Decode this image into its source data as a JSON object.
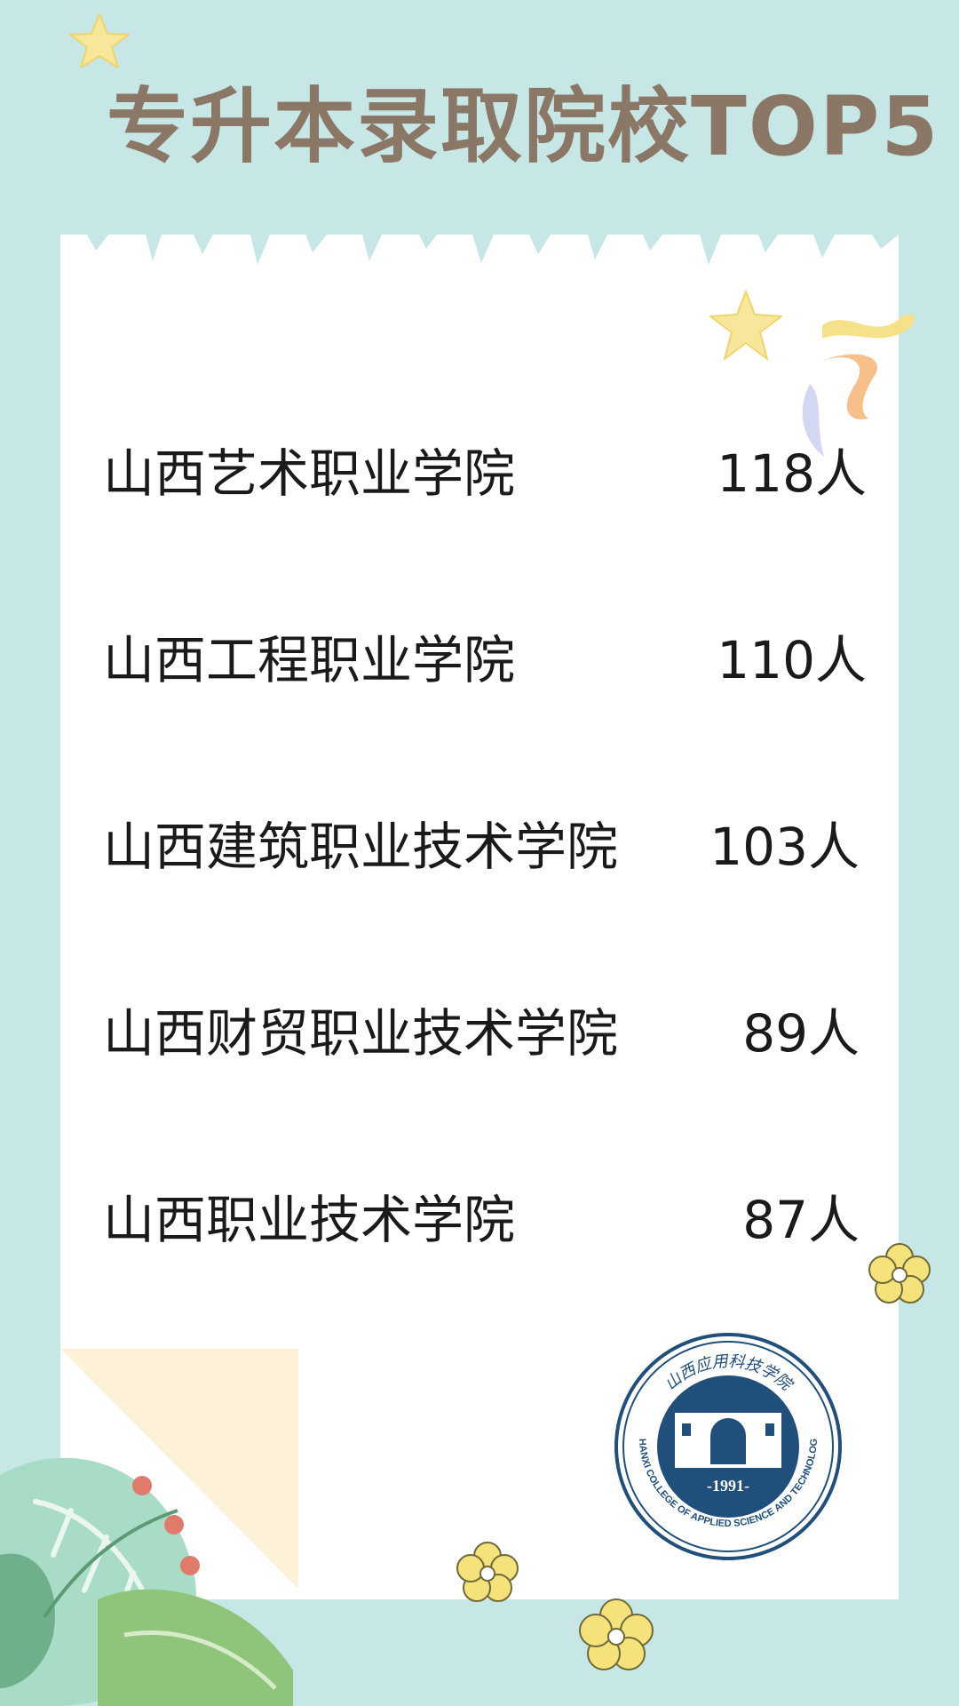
{
  "title": "专升本录取院校TOP5",
  "colors": {
    "background": "#c7e6e6",
    "title": "#8b7766",
    "paper": "#ffffff",
    "seal": "#1f4f7a",
    "star": "#f7e79a",
    "flower": "#f5e27a"
  },
  "ranking": [
    {
      "name": "山西艺术职业学院",
      "count": "118人"
    },
    {
      "name": "山西工程职业学院",
      "count": "110人"
    },
    {
      "name": "山西建筑职业技术学院",
      "count": "103人"
    },
    {
      "name": "山西财贸职业技术学院",
      "count": "89人"
    },
    {
      "name": "山西职业技术学院",
      "count": "87人"
    }
  ],
  "seal": {
    "chinese": "山西应用科技学院",
    "english": "SHANXI COLLEGE OF APPLIED SCIENCE AND TECHNOLOGY",
    "year": "-1991-"
  },
  "icons": [
    "star-icon",
    "flower-icon",
    "leaf-decoration",
    "school-seal-logo"
  ]
}
